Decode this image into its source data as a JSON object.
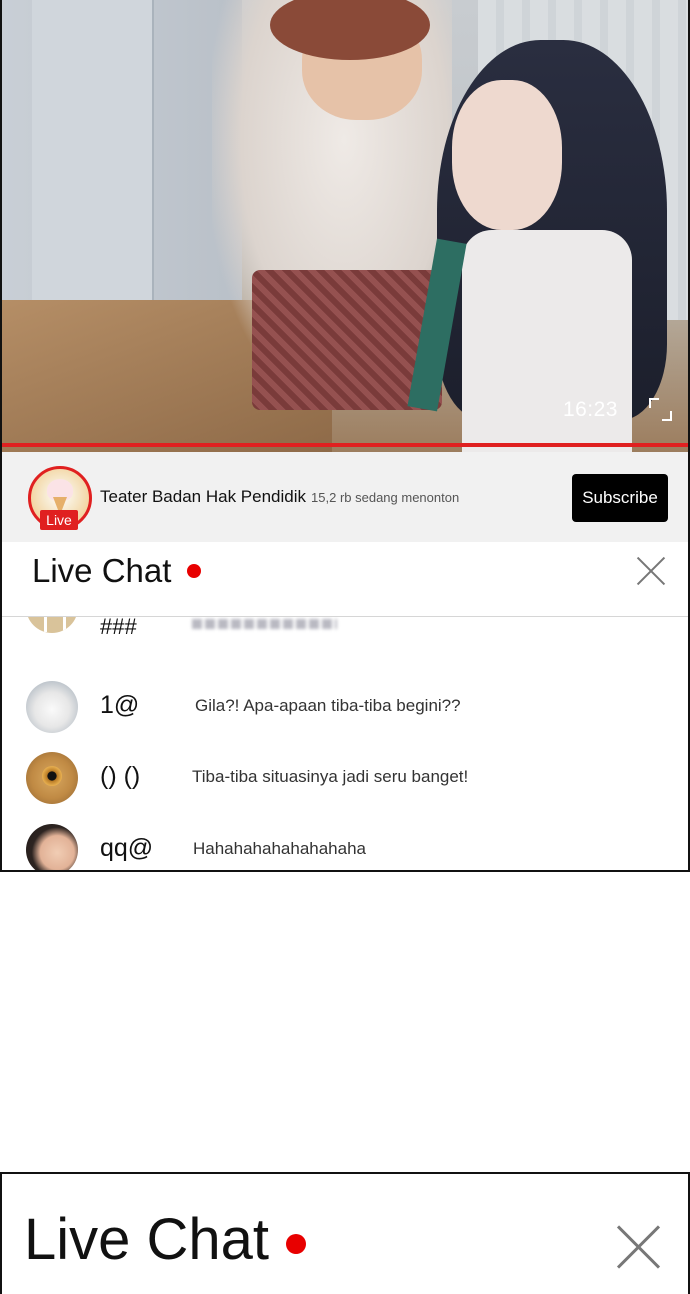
{
  "video": {
    "time": "16:23",
    "progress": 1.0,
    "progress_color": "#e02020"
  },
  "channel": {
    "name": "Teater Badan Hak Pendidik",
    "viewers": "15,2 rb sedang menonton",
    "live_badge": "Live",
    "subscribe_label": "Subscribe"
  },
  "chat": {
    "title": "Live Chat",
    "live_dot_color": "#e80000",
    "messages": [
      {
        "user": "###",
        "text": ""
      },
      {
        "user": "1@",
        "text": "Gila?! Apa-apaan tiba-tiba begini??"
      },
      {
        "user": "() ()",
        "text": "Tiba-tiba situasinya jadi seru banget!"
      },
      {
        "user": "qq@",
        "text": "Hahahahahahahahaha"
      }
    ]
  },
  "chat_bottom": {
    "title": "Live Chat"
  }
}
